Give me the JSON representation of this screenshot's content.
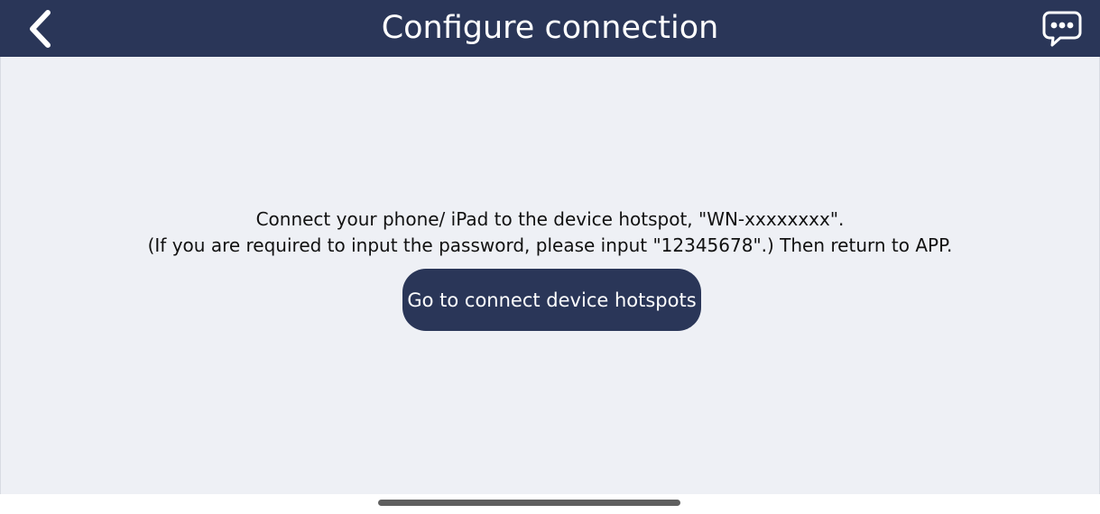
{
  "header": {
    "title": "Configure connection",
    "back_icon": "chevron-left-icon",
    "chat_icon": "chat-bubble-icon"
  },
  "main": {
    "instruction_line1": "Connect your phone/ iPad to the device hotspot, \"WN-xxxxxxxx\".",
    "instruction_line2": "(If you are required to input the password, please input \"12345678\".) Then return to APP.",
    "connect_button_label": "Go to connect device hotspots"
  },
  "colors": {
    "nav_background": "#2a3658",
    "content_background": "#eef0f5",
    "button_background": "#2a3658",
    "button_text": "#ffffff"
  }
}
